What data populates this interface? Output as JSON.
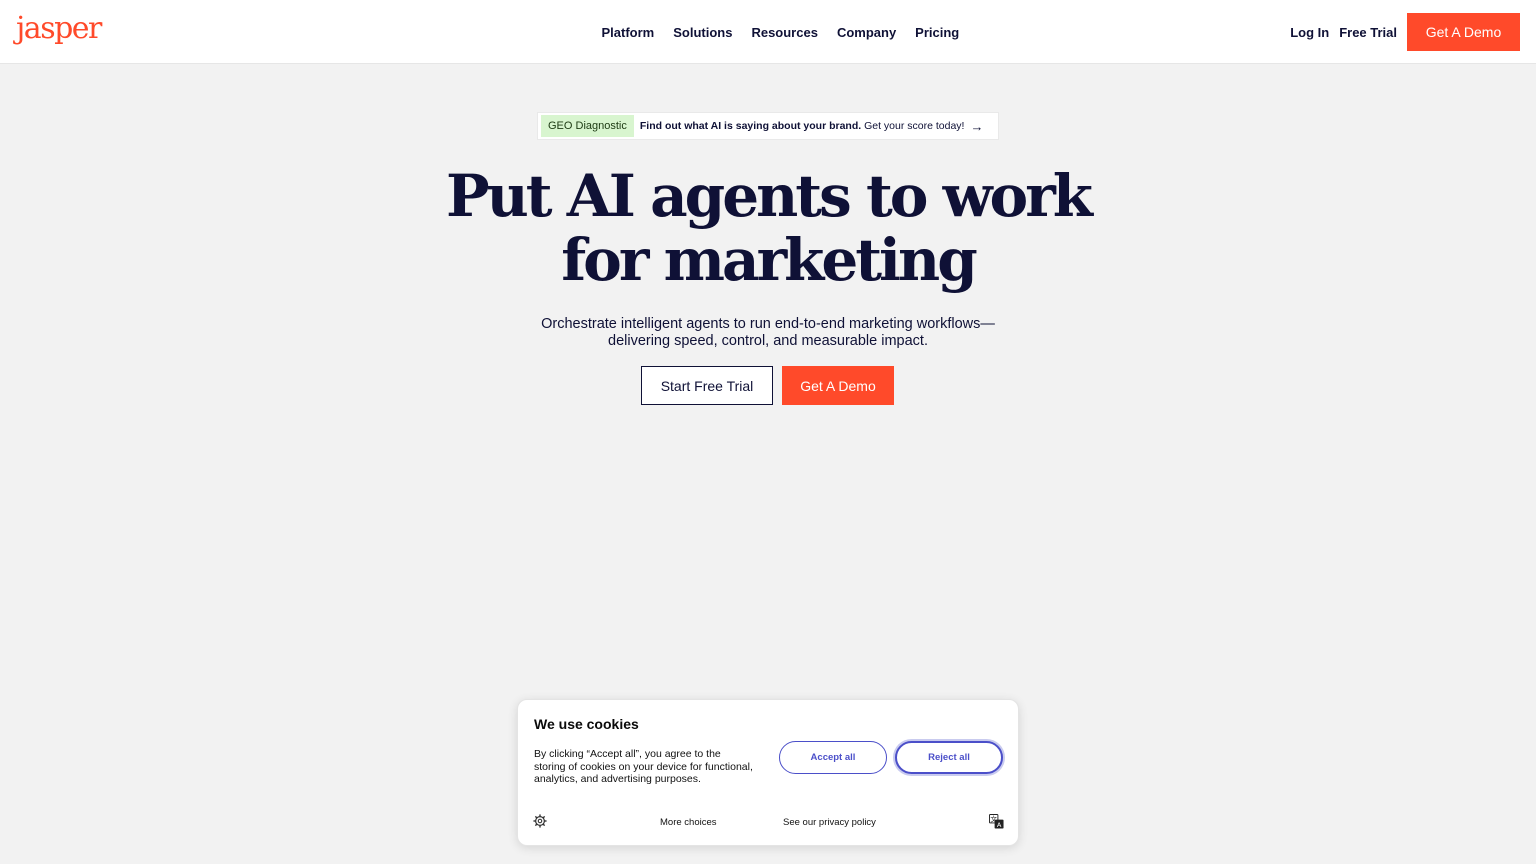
{
  "header": {
    "logo": "jasper",
    "nav": [
      "Platform",
      "Solutions",
      "Resources",
      "Company",
      "Pricing"
    ],
    "login": "Log In",
    "free_trial": "Free Trial",
    "demo": "Get A Demo"
  },
  "announcement": {
    "badge": "GEO Diagnostic",
    "bold": "Find out what AI is saying about your brand.",
    "rest": "Get your score today!",
    "arrow_icon": "arrow-right-icon"
  },
  "hero": {
    "title_line1": "Put AI agents to work",
    "title_line2": "for marketing",
    "sub_line1": "Orchestrate intelligent agents to run end-to-end marketing workflows—",
    "sub_line2": "delivering speed, control, and measurable impact.",
    "btn_trial": "Start Free Trial",
    "btn_demo": "Get A Demo"
  },
  "cookie": {
    "title": "We use cookies",
    "description": "By clicking “Accept all”, you agree to the storing of cookies on your device for functional, analytics, and advertising purposes.",
    "accept": "Accept all",
    "reject": "Reject all",
    "more": "More choices",
    "privacy": "See our privacy policy",
    "settings_icon": "gear-icon",
    "translate_icon": "translate-icon"
  },
  "colors": {
    "brand": "#ff4a2a",
    "ink": "#0f1136",
    "cookie_accent": "#4b4fc9",
    "badge_bg": "#d8f5cf"
  }
}
